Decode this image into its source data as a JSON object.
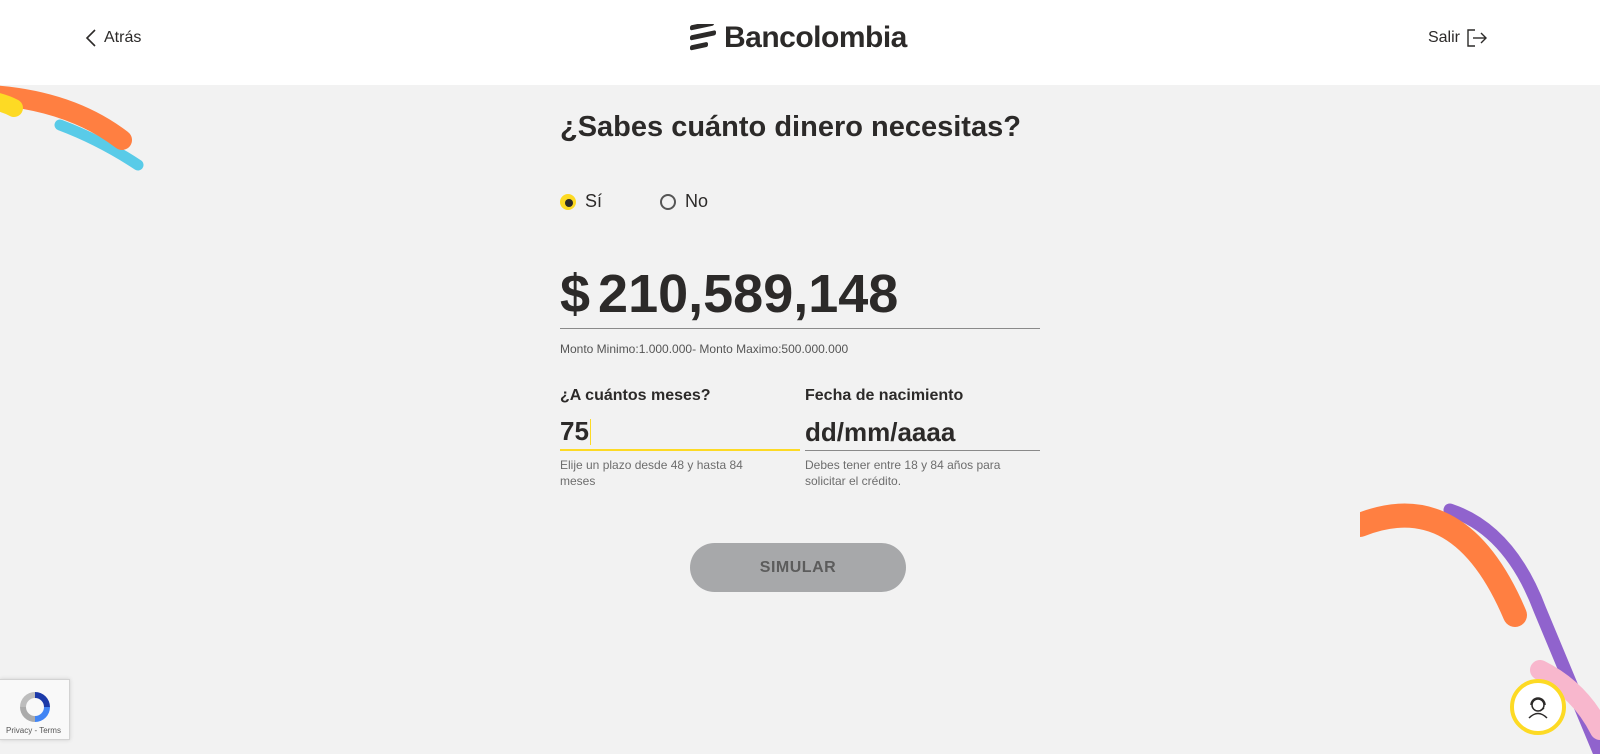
{
  "header": {
    "back_label": "Atrás",
    "brand_name": "Bancolombia",
    "exit_label": "Salir"
  },
  "form": {
    "title": "¿Sabes cuánto dinero necesitas?",
    "options": [
      {
        "label": "Sí",
        "selected": true
      },
      {
        "label": "No",
        "selected": false
      }
    ],
    "amount": {
      "currency_symbol": "$",
      "value": "210,589,148",
      "hint": "Monto Minimo:1.000.000- Monto Maximo:500.000.000"
    },
    "months": {
      "label": "¿A cuántos meses?",
      "value": "75",
      "help": "Elije un plazo desde 48 y hasta 84 meses"
    },
    "birthdate": {
      "label": "Fecha de nacimiento",
      "placeholder": "dd/mm/aaaa",
      "help": "Debes tener entre 18 y 84 años para solicitar el crédito."
    },
    "submit_label": "SIMULAR"
  },
  "recaptcha": {
    "links": "Privacy - Terms"
  },
  "colors": {
    "accent_yellow": "#fdda24",
    "background": "#f2f2f2",
    "text": "#2c2a29",
    "button_disabled": "#a7a8aa",
    "deco_orange": "#ff7f41",
    "deco_blue": "#59cbe8",
    "deco_purple": "#9063cd",
    "deco_pink": "#f8b7cd"
  },
  "icons": [
    "chevron-left-icon",
    "bancolombia-logo-icon",
    "exit-icon",
    "recaptcha-icon",
    "support-agent-icon"
  ]
}
